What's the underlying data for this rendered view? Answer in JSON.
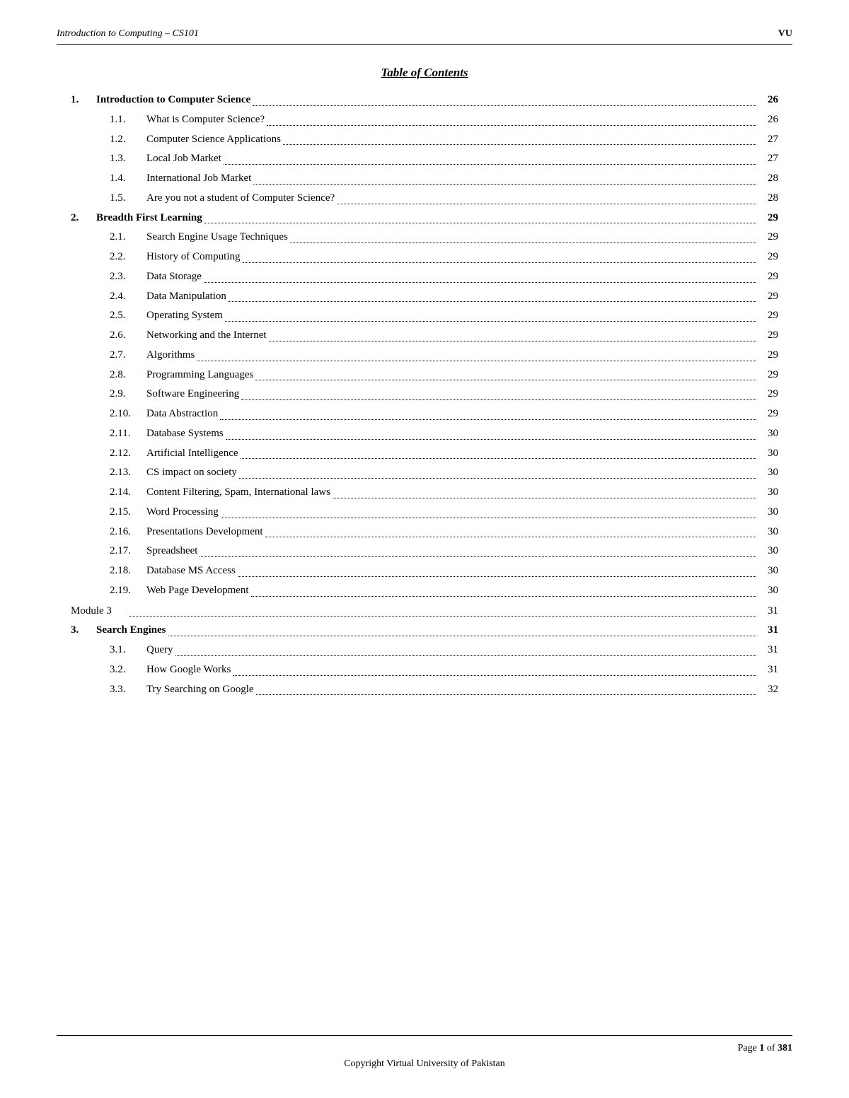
{
  "header": {
    "title": "Introduction to Computing – CS101",
    "logo": "VU"
  },
  "toc": {
    "heading": "Table of Contents",
    "entries": [
      {
        "level": 1,
        "num": "1.",
        "text": "Introduction to Computer Science",
        "dots": true,
        "page": "26"
      },
      {
        "level": 2,
        "num": "1.1.",
        "text": "What is Computer Science?",
        "dots": true,
        "page": "26"
      },
      {
        "level": 2,
        "num": "1.2.",
        "text": "Computer Science Applications",
        "dots": true,
        "page": "27"
      },
      {
        "level": 2,
        "num": "1.3.",
        "text": "Local Job Market",
        "dots": true,
        "page": "27"
      },
      {
        "level": 2,
        "num": "1.4.",
        "text": "International Job Market",
        "dots": true,
        "page": "28"
      },
      {
        "level": 2,
        "num": "1.5.",
        "text": "Are you not a student of Computer Science?",
        "dots": true,
        "page": "28"
      },
      {
        "level": 1,
        "num": "2.",
        "text": "Breadth First Learning",
        "dots": true,
        "page": "29"
      },
      {
        "level": 2,
        "num": "2.1.",
        "text": "Search Engine Usage Techniques",
        "dots": true,
        "page": "29"
      },
      {
        "level": 2,
        "num": "2.2.",
        "text": "History of Computing",
        "dots": true,
        "page": "29"
      },
      {
        "level": 2,
        "num": "2.3.",
        "text": "Data Storage",
        "dots": true,
        "page": "29"
      },
      {
        "level": 2,
        "num": "2.4.",
        "text": "Data Manipulation",
        "dots": true,
        "page": "29"
      },
      {
        "level": 2,
        "num": "2.5.",
        "text": "Operating System",
        "dots": true,
        "page": "29"
      },
      {
        "level": 2,
        "num": "2.6.",
        "text": "Networking and the Internet",
        "dots": true,
        "page": "29"
      },
      {
        "level": 2,
        "num": "2.7.",
        "text": "Algorithms",
        "dots": true,
        "page": "29"
      },
      {
        "level": 2,
        "num": "2.8.",
        "text": "Programming Languages",
        "dots": true,
        "page": "29"
      },
      {
        "level": 2,
        "num": "2.9.",
        "text": "Software Engineering",
        "dots": true,
        "page": "29"
      },
      {
        "level": 2,
        "num": "2.10.",
        "text": "Data Abstraction",
        "dots": true,
        "page": "29"
      },
      {
        "level": 2,
        "num": "2.11.",
        "text": "Database Systems",
        "dots": true,
        "page": "30"
      },
      {
        "level": 2,
        "num": "2.12.",
        "text": "Artificial Intelligence",
        "dots": true,
        "page": "30"
      },
      {
        "level": 2,
        "num": "2.13.",
        "text": "CS impact on society",
        "dots": true,
        "page": "30"
      },
      {
        "level": 2,
        "num": "2.14.",
        "text": "Content Filtering, Spam, International laws",
        "dots": true,
        "page": "30"
      },
      {
        "level": 2,
        "num": "2.15.",
        "text": "Word Processing",
        "dots": true,
        "page": "30"
      },
      {
        "level": 2,
        "num": "2.16.",
        "text": "Presentations Development",
        "dots": true,
        "page": "30"
      },
      {
        "level": 2,
        "num": "2.17.",
        "text": "Spreadsheet",
        "dots": true,
        "page": "30"
      },
      {
        "level": 2,
        "num": "2.18.",
        "text": "Database MS Access",
        "dots": true,
        "page": "30"
      },
      {
        "level": 2,
        "num": "2.19.",
        "text": "Web Page Development",
        "dots": true,
        "page": "30"
      },
      {
        "level": 0,
        "num": "Module 3",
        "text": "",
        "dots": true,
        "page": "31"
      },
      {
        "level": 1,
        "num": "3.",
        "text": "Search Engines",
        "dots": true,
        "page": "31"
      },
      {
        "level": 2,
        "num": "3.1.",
        "text": "Query",
        "dots": true,
        "page": "31"
      },
      {
        "level": 2,
        "num": "3.2.",
        "text": "How Google Works",
        "dots": true,
        "page": "31"
      },
      {
        "level": 2,
        "num": "3.3.",
        "text": "Try Searching on Google",
        "dots": true,
        "page": "32"
      }
    ]
  },
  "footer": {
    "page_label": "Page",
    "page_current": "1",
    "page_of": "of",
    "page_total": "381",
    "copyright": "Copyright Virtual University of Pakistan"
  }
}
